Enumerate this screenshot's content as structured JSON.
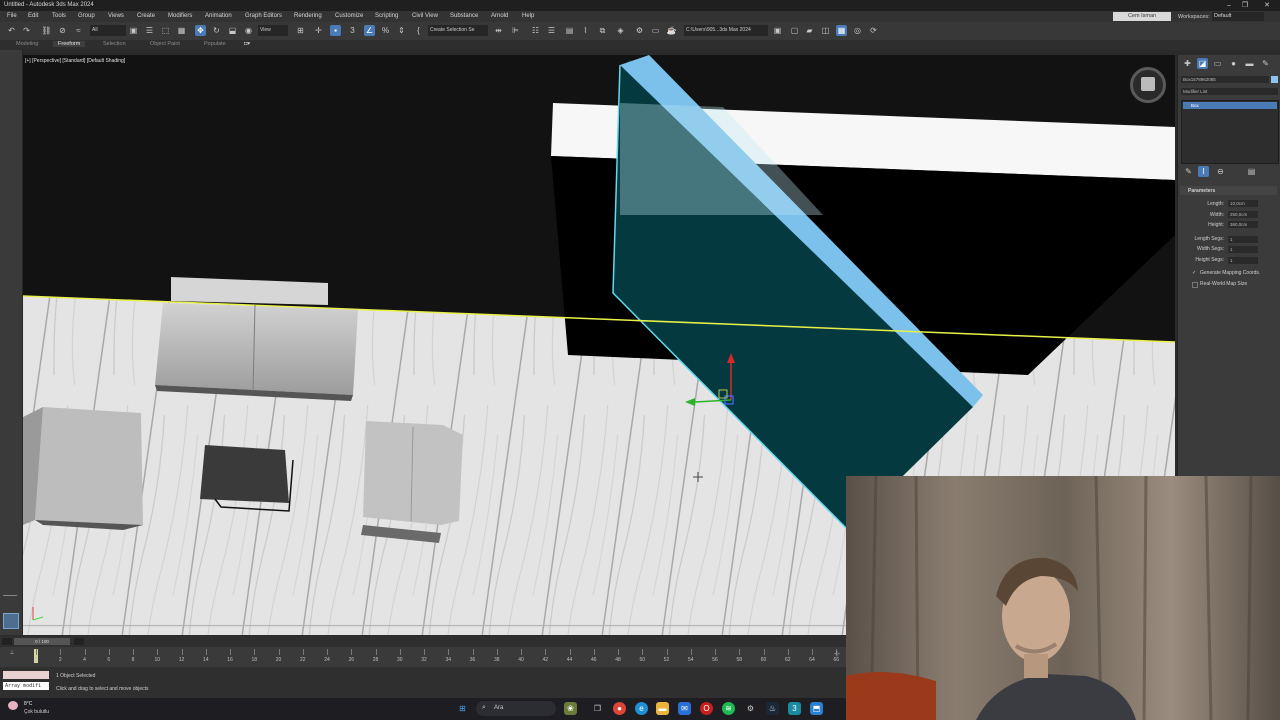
{
  "app": {
    "title": "Untitled - Autodesk 3ds Max 2024",
    "user_button": "Cem Isman",
    "workspaces_label": "Workspaces:",
    "workspace_value": "Default"
  },
  "menu": [
    "File",
    "Edit",
    "Tools",
    "Group",
    "Views",
    "Create",
    "Modifiers",
    "Animation",
    "Graph Editors",
    "Rendering",
    "Customize",
    "Scripting",
    "Civil View",
    "Substance",
    "Arnold",
    "Help"
  ],
  "toolbar": {
    "selection_filter": "All",
    "ref_coord": "View",
    "named_selection": "Create Selection Se",
    "project_path": "C:\\Users\\905...3ds Max 2024"
  },
  "ribbon_tabs": [
    "Modeling",
    "Freeform",
    "Selection",
    "Object Paint",
    "Populate"
  ],
  "viewport": {
    "label": "[+] [Perspective] [Standard] [Default Shading]"
  },
  "command_panel": {
    "object_name": "Box1578962085",
    "modifier_list": "Modifier List",
    "stack_item": "Box",
    "rollout_title": "Parameters",
    "params": [
      {
        "label": "Length:",
        "value": "10,0cm"
      },
      {
        "label": "Width:",
        "value": "250,0cm"
      },
      {
        "label": "Height:",
        "value": "360,0cm"
      }
    ],
    "segs": [
      {
        "label": "Length Segs:",
        "value": "1"
      },
      {
        "label": "Width Segs:",
        "value": "1"
      },
      {
        "label": "Height Segs:",
        "value": "1"
      }
    ],
    "gen_mapping": "Generate Mapping Coords.",
    "real_world": "Real-World Map Size"
  },
  "timeline": {
    "frame_label": "0 / 100",
    "ticks": [
      "0",
      "2",
      "4",
      "6",
      "8",
      "10",
      "12",
      "14",
      "16",
      "18",
      "20",
      "22",
      "24",
      "26",
      "28",
      "30",
      "32",
      "34",
      "36",
      "38",
      "40",
      "42",
      "44",
      "46",
      "48",
      "50",
      "52",
      "54",
      "56",
      "58",
      "60",
      "62",
      "64",
      "66"
    ]
  },
  "status": {
    "selected": "1 Object Selected",
    "prompt": "Click and drag to select and move objects",
    "maxscript_field": "Array modifi"
  },
  "taskbar": {
    "weather_temp": "8°C",
    "weather_text": "Çok bulutlu",
    "search": "Ara"
  },
  "colors": {
    "accent": "#4a7bb7",
    "selection_cyan": "#63d8f0",
    "glass_blue": "#7cc1ec",
    "horizon_yellow": "#e8f04a"
  }
}
